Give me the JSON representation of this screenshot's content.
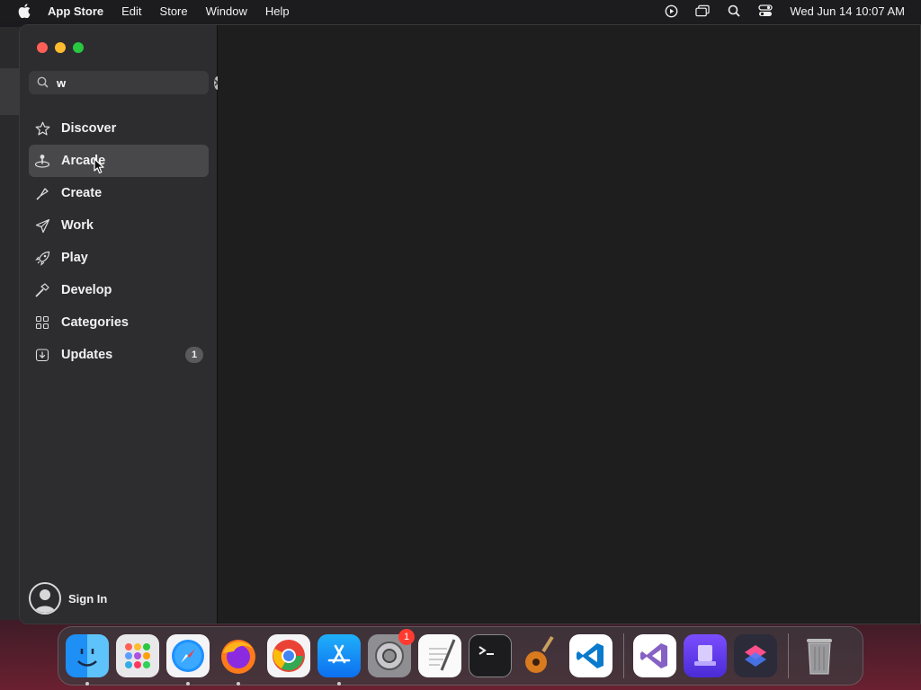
{
  "menubar": {
    "app_name": "App Store",
    "menus": [
      "Edit",
      "Store",
      "Window",
      "Help"
    ],
    "clock": "Wed Jun 14  10:07 AM"
  },
  "search": {
    "value": "w",
    "placeholder": "Search"
  },
  "sidebar": {
    "items": [
      {
        "label": "Discover",
        "icon": "star-icon"
      },
      {
        "label": "Arcade",
        "icon": "joystick-icon",
        "selected": true
      },
      {
        "label": "Create",
        "icon": "brush-icon"
      },
      {
        "label": "Work",
        "icon": "paper-plane-icon"
      },
      {
        "label": "Play",
        "icon": "rocket-icon"
      },
      {
        "label": "Develop",
        "icon": "hammer-icon"
      },
      {
        "label": "Categories",
        "icon": "grid-icon"
      },
      {
        "label": "Updates",
        "icon": "download-icon",
        "badge": "1"
      }
    ],
    "signin_label": "Sign In"
  },
  "dock": {
    "apps": [
      "finder-icon",
      "launchpad-icon",
      "safari-icon",
      "firefox-icon",
      "chrome-icon",
      "app-store-icon",
      "system-settings-icon",
      "textedit-icon",
      "terminal-icon",
      "garageband-icon",
      "vscode-icon",
      "visual-studio-icon",
      "apple-configurator-icon",
      "shortcuts-icon",
      "trash-icon"
    ],
    "settings_badge": "1"
  },
  "colors": {
    "selected_row": "#48484a",
    "sidebar_bg": "#2d2d2f",
    "content_bg": "#1e1e1e",
    "badge_red": "#ff3b30"
  }
}
